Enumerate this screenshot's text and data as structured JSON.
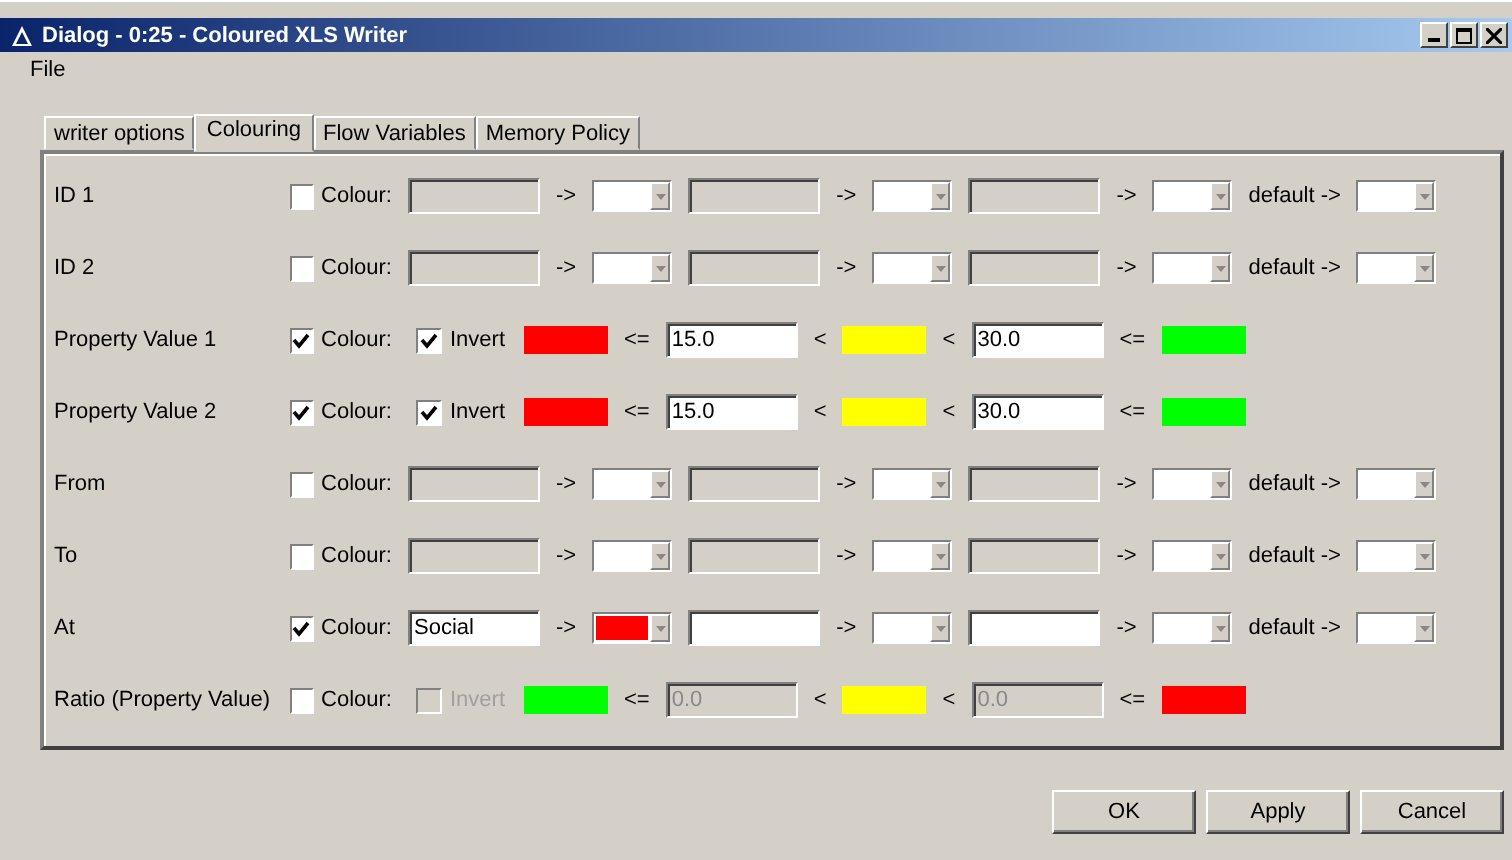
{
  "window": {
    "title": "Dialog - 0:25 - Coloured XLS Writer"
  },
  "menu": [
    "File"
  ],
  "tabs": [
    {
      "label": "writer options",
      "selected": false
    },
    {
      "label": "Colouring",
      "selected": true
    },
    {
      "label": "Flow Variables",
      "selected": false
    },
    {
      "label": "Memory Policy",
      "selected": false
    }
  ],
  "rows": [
    {
      "kind": "nominal",
      "label": "ID 1",
      "colour_label": "Colour:",
      "colour_checked": false,
      "pairs": [
        {
          "arrow": "->"
        },
        {
          "arrow": "->"
        },
        {
          "arrow": "->"
        }
      ],
      "default_label": "default ->"
    },
    {
      "kind": "nominal",
      "label": "ID 2",
      "colour_label": "Colour:",
      "colour_checked": false,
      "pairs": [
        {
          "arrow": "->"
        },
        {
          "arrow": "->"
        },
        {
          "arrow": "->"
        }
      ],
      "default_label": "default ->"
    },
    {
      "kind": "range",
      "label": "Property Value 1",
      "colour_label": "Colour:",
      "colour_checked": true,
      "invert_label": "Invert",
      "invert_checked": true,
      "swatches": [
        {
          "color": "#ff0000"
        },
        {
          "color": "#ffff00"
        },
        {
          "color": "#00ff00"
        }
      ],
      "ops": [
        "<=",
        "<",
        "<",
        "<="
      ],
      "thresholds": [
        "15.0",
        "30.0"
      ]
    },
    {
      "kind": "range",
      "label": "Property Value 2",
      "colour_label": "Colour:",
      "colour_checked": true,
      "invert_label": "Invert",
      "invert_checked": true,
      "swatches": [
        {
          "color": "#ff0000"
        },
        {
          "color": "#ffff00"
        },
        {
          "color": "#00ff00"
        }
      ],
      "ops": [
        "<=",
        "<",
        "<",
        "<="
      ],
      "thresholds": [
        "15.0",
        "30.0"
      ]
    },
    {
      "kind": "nominal",
      "label": "From",
      "colour_label": "Colour:",
      "colour_checked": false,
      "pairs": [
        {
          "arrow": "->"
        },
        {
          "arrow": "->"
        },
        {
          "arrow": "->"
        }
      ],
      "default_label": "default ->"
    },
    {
      "kind": "nominal",
      "label": "To",
      "colour_label": "Colour:",
      "colour_checked": false,
      "pairs": [
        {
          "arrow": "->"
        },
        {
          "arrow": "->"
        },
        {
          "arrow": "->"
        }
      ],
      "default_label": "default ->"
    },
    {
      "kind": "nominal",
      "label": "At",
      "colour_label": "Colour:",
      "colour_checked": true,
      "pairs": [
        {
          "value": "Social",
          "arrow": "->",
          "color": "#ff0000"
        },
        {
          "arrow": "->"
        },
        {
          "arrow": "->"
        }
      ],
      "default_label": "default ->"
    },
    {
      "kind": "range",
      "label": "Ratio (Property Value)",
      "colour_label": "Colour:",
      "colour_checked": false,
      "invert_label": "Invert",
      "invert_checked": false,
      "swatches": [
        {
          "color": "#00ff00"
        },
        {
          "color": "#ffff00"
        },
        {
          "color": "#ff0000"
        }
      ],
      "ops": [
        "<=",
        "<",
        "<",
        "<="
      ],
      "thresholds": [
        "0.0",
        "0.0"
      ]
    }
  ],
  "buttons": [
    "OK",
    "Apply",
    "Cancel"
  ]
}
